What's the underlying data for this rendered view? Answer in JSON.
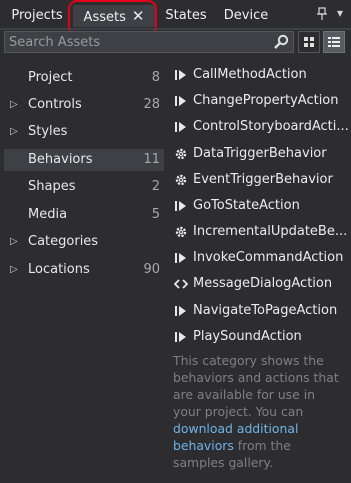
{
  "tabs": [
    {
      "label": "Projects"
    },
    {
      "label": "Assets"
    },
    {
      "label": "States"
    },
    {
      "label": "Device"
    }
  ],
  "tab_close_glyph": "✕",
  "pin_glyph": "ᵖ",
  "menu_glyph": "▾",
  "search": {
    "placeholder": "Search Assets",
    "value": ""
  },
  "categories": [
    {
      "label": "Project",
      "count": "8",
      "expandable": false
    },
    {
      "label": "Controls",
      "count": "28",
      "expandable": true
    },
    {
      "label": "Styles",
      "count": "",
      "expandable": true
    },
    {
      "label": "Behaviors",
      "count": "11",
      "expandable": false,
      "selected": true
    },
    {
      "label": "Shapes",
      "count": "2",
      "expandable": false
    },
    {
      "label": "Media",
      "count": "5",
      "expandable": false
    },
    {
      "label": "Categories",
      "count": "",
      "expandable": true
    },
    {
      "label": "Locations",
      "count": "90",
      "expandable": true
    }
  ],
  "items": [
    {
      "label": "CallMethodAction",
      "icon": "action-icon"
    },
    {
      "label": "ChangePropertyAction",
      "icon": "action-icon"
    },
    {
      "label": "ControlStoryboardActi...",
      "icon": "action-icon"
    },
    {
      "label": "DataTriggerBehavior",
      "icon": "gear-icon"
    },
    {
      "label": "EventTriggerBehavior",
      "icon": "gear-icon"
    },
    {
      "label": "GoToStateAction",
      "icon": "action-icon"
    },
    {
      "label": "IncrementalUpdateBe...",
      "icon": "gear-icon"
    },
    {
      "label": "InvokeCommandAction",
      "icon": "action-icon"
    },
    {
      "label": "MessageDialogAction",
      "icon": "code-icon"
    },
    {
      "label": "NavigateToPageAction",
      "icon": "action-icon"
    },
    {
      "label": "PlaySoundAction",
      "icon": "action-icon"
    }
  ],
  "description": {
    "before": "This category shows the behaviors and actions that are available for use in your project. You can ",
    "link": "download additional behaviors",
    "after": " from the samples gallery."
  },
  "colors": {
    "accent_link": "#6fb3e8",
    "highlight": "#e3001b",
    "background": "#2d2d30"
  }
}
